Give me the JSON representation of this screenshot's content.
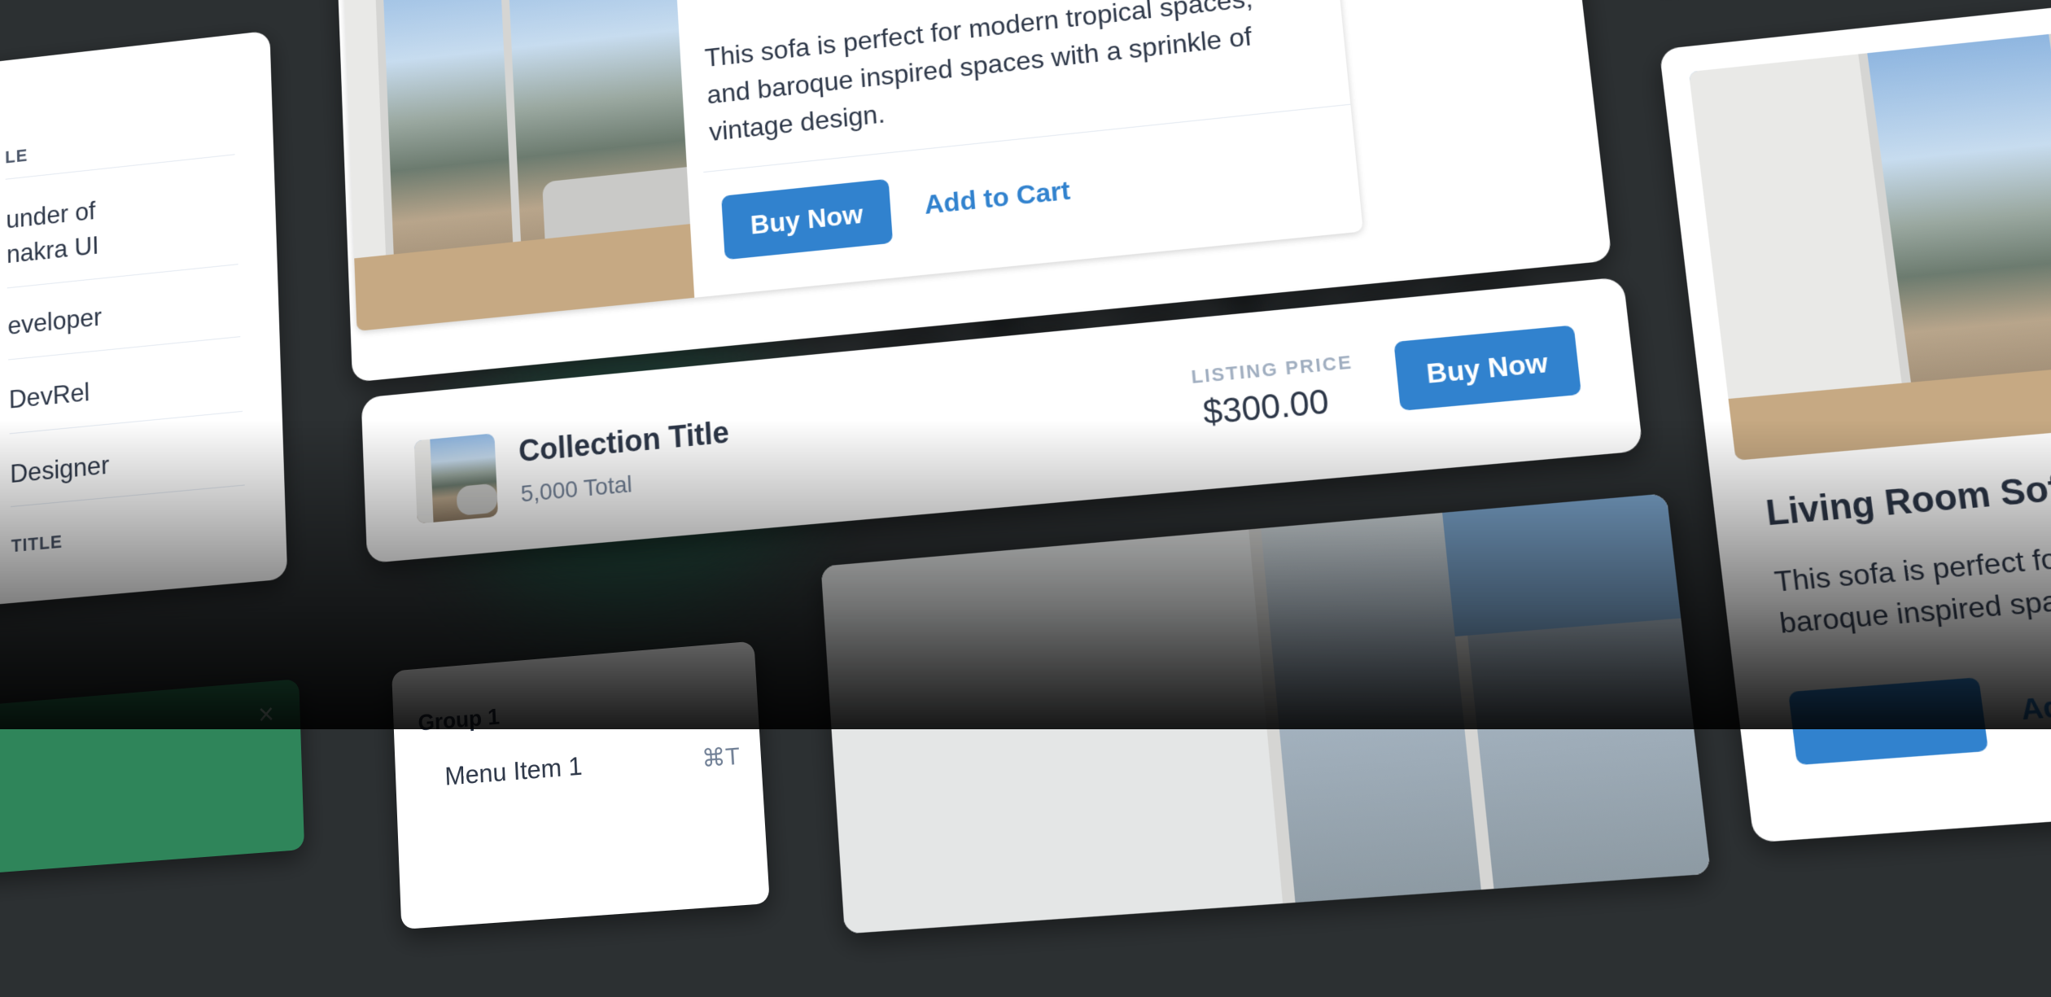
{
  "left_table": {
    "header": "TITLE",
    "header_partial": "LE",
    "rows": [
      "Founder of Chakra UI",
      "Developer",
      "DevRel",
      "Designer"
    ],
    "row_partials": [
      "under of",
      "nakra UI",
      "eveloper",
      "DevRel",
      "Designer"
    ],
    "footer_partial": "TITLE"
  },
  "product_card_top": {
    "description": "This sofa is perfect for modern tropical spaces, and baroque inspired spaces with a sprinkle of vintage design.",
    "desc_lines": [
      "This sofa is perfect for modern tropical spaces,",
      "and baroque inspired spaces with a sprinkle of",
      "vintage design."
    ],
    "buy_label": "Buy Now",
    "cart_label": "Add to Cart"
  },
  "collection_card": {
    "title": "Collection Title",
    "subtitle": "5,000 Total",
    "price_label": "LISTING PRICE",
    "price": "$300.00",
    "buy_label": "Buy Now"
  },
  "menu": {
    "group": "Group 1",
    "item": "Menu Item 1",
    "shortcut": "⌘T"
  },
  "right_card": {
    "title": "Living Room Sofa",
    "desc_lines": [
      "This sofa is perfect for mod",
      "baroque inspired spaces wi"
    ],
    "cart_partial": "Add to C"
  },
  "toast": {
    "close_glyph": "×"
  },
  "colors": {
    "accent": "#3182ce",
    "background": "#2c3032",
    "toast": "#2f855a"
  }
}
